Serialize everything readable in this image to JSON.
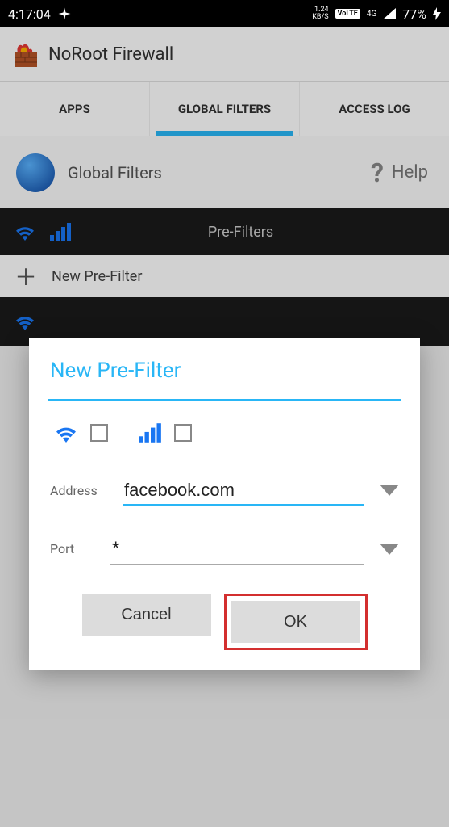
{
  "status": {
    "time": "4:17:04",
    "speed_top": "1.24",
    "speed_bot": "KB/S",
    "volte": "VoLTE",
    "net": "4G",
    "battery": "77%"
  },
  "app": {
    "title": "NoRoot Firewall"
  },
  "tabs": {
    "apps": "APPS",
    "global_filters": "GLOBAL FILTERS",
    "access_log": "ACCESS LOG"
  },
  "section": {
    "title": "Global Filters",
    "help": "Help"
  },
  "filters": {
    "bar_title": "Pre-Filters",
    "new": "New Pre-Filter"
  },
  "dialog": {
    "title": "New Pre-Filter",
    "address_label": "Address",
    "address_value": "facebook.com",
    "port_label": "Port",
    "port_value": "*",
    "cancel": "Cancel",
    "ok": "OK"
  }
}
